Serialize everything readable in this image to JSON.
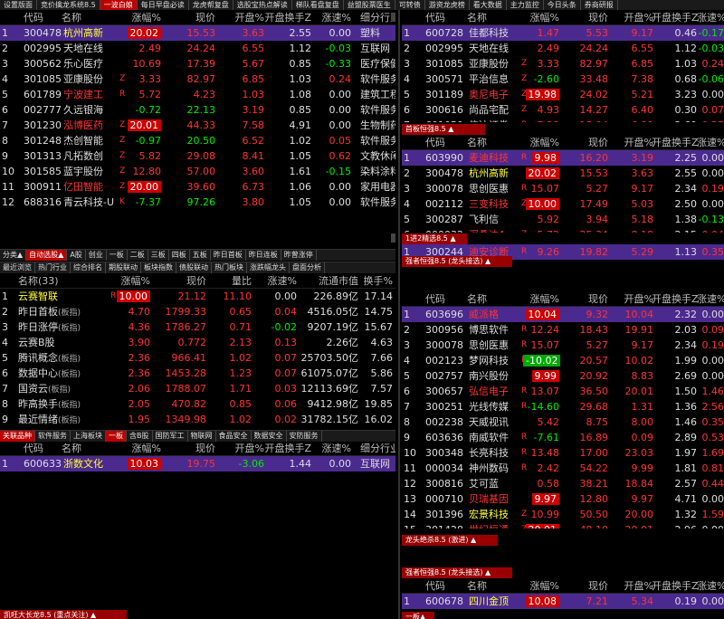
{
  "top_tabs": [
    {
      "label": "设置版面",
      "on": false
    },
    {
      "label": "竞价擒龙系统8.5",
      "on": false
    },
    {
      "label": "一波白娘",
      "on": true
    },
    {
      "label": "每日早盘必读",
      "on": false
    },
    {
      "label": "龙虎帮复盘",
      "on": false
    },
    {
      "label": "选股宝热点解读",
      "on": false
    },
    {
      "label": "梯队看盘复盘",
      "on": false
    },
    {
      "label": "益盟股票医生",
      "on": false
    },
    {
      "label": "可转债",
      "on": false
    },
    {
      "label": "游资龙虎榜",
      "on": false
    },
    {
      "label": "看大数据",
      "on": false
    },
    {
      "label": "主力监控",
      "on": false
    },
    {
      "label": "今日头条",
      "on": false
    },
    {
      "label": "券商研报",
      "on": false
    }
  ],
  "left_table": {
    "headers": {
      "code": "代码",
      "name": "名称",
      "chg": "涨幅%",
      "price": "现价",
      "open": "开盘%",
      "turn": "开盘换手Z",
      "speed": "涨速%",
      "ind": "细分行业"
    },
    "rows": [
      {
        "i": "1",
        "code": "300478",
        "name": "杭州高新",
        "mk": "",
        "chg": "20.02",
        "price": "15.53",
        "open": "3.63",
        "turn": "2.55",
        "speed": "0.00",
        "ind": "塑料",
        "cc": "red",
        "box": "r",
        "hl": true
      },
      {
        "i": "2",
        "code": "002995",
        "name": "天地在线",
        "mk": "",
        "chg": "2.49",
        "price": "24.24",
        "open": "6.55",
        "turn": "1.12",
        "speed": "-0.03",
        "ind": "互联网",
        "cc": "red",
        "box": "",
        "hl": false
      },
      {
        "i": "3",
        "code": "300562",
        "name": "乐心医疗",
        "mk": "",
        "chg": "10.69",
        "price": "17.39",
        "open": "5.67",
        "turn": "0.85",
        "speed": "-0.33",
        "ind": "医疗保健",
        "cc": "red",
        "box": "",
        "hl": false
      },
      {
        "i": "4",
        "code": "301085",
        "name": "亚康股份",
        "mk": "Z",
        "chg": "3.33",
        "price": "82.97",
        "open": "6.85",
        "turn": "1.03",
        "speed": "0.24",
        "ind": "软件服务",
        "cc": "red",
        "box": "",
        "hl": false
      },
      {
        "i": "5",
        "code": "601789",
        "name": "宁波建工",
        "mk": "R",
        "chg": "5.72",
        "price": "4.23",
        "open": "1.03",
        "turn": "1.08",
        "speed": "0.00",
        "ind": "建筑工程",
        "cc": "red",
        "box": "",
        "hl": false
      },
      {
        "i": "6",
        "code": "002777",
        "name": "久远银海",
        "mk": "",
        "chg": "-0.72",
        "price": "22.13",
        "open": "3.19",
        "turn": "0.85",
        "speed": "0.00",
        "ind": "软件服务",
        "cc": "grn",
        "box": "",
        "hl": false
      },
      {
        "i": "7",
        "code": "301230",
        "name": "泓博医药",
        "mk": "Z",
        "chg": "20.01",
        "price": "44.33",
        "open": "7.58",
        "turn": "4.91",
        "speed": "0.00",
        "ind": "生物制药",
        "cc": "red",
        "box": "r",
        "hl": false
      },
      {
        "i": "8",
        "code": "301248",
        "name": "杰创智能",
        "mk": "Z",
        "chg": "-0.97",
        "price": "20.50",
        "open": "6.52",
        "turn": "1.02",
        "speed": "0.05",
        "ind": "软件服务",
        "cc": "grn",
        "box": "",
        "hl": false
      },
      {
        "i": "9",
        "code": "301313",
        "name": "凡拓数创",
        "mk": "Z",
        "chg": "5.82",
        "price": "29.08",
        "open": "8.41",
        "turn": "1.05",
        "speed": "0.62",
        "ind": "文教休闲",
        "cc": "red",
        "box": "",
        "hl": false
      },
      {
        "i": "10",
        "code": "301585",
        "name": "蓝宇股份",
        "mk": "Z",
        "chg": "12.80",
        "price": "57.00",
        "open": "3.60",
        "turn": "1.61",
        "speed": "-0.15",
        "ind": "染料涂料",
        "cc": "red",
        "box": "",
        "hl": false
      },
      {
        "i": "11",
        "code": "300911",
        "name": "亿田智能",
        "mk": "Z",
        "chg": "20.00",
        "price": "39.60",
        "open": "6.73",
        "turn": "1.06",
        "speed": "0.00",
        "ind": "家用电器",
        "cc": "red",
        "box": "r",
        "hl": false
      },
      {
        "i": "12",
        "code": "688316",
        "name": "青云科技-U",
        "mk": "K",
        "chg": "-7.37",
        "price": "97.26",
        "open": "3.80",
        "turn": "1.05",
        "speed": "0.00",
        "ind": "软件服务",
        "cc": "grn",
        "box": "",
        "hl": false
      }
    ]
  },
  "mid_bar1": [
    {
      "label": "分类▲",
      "on": false
    },
    {
      "label": "自动选股▲",
      "on": true
    },
    {
      "label": "A股",
      "on": false
    },
    {
      "label": "创业",
      "on": false
    },
    {
      "label": "一板",
      "on": false
    },
    {
      "label": "二板",
      "on": false
    },
    {
      "label": "三板",
      "on": false
    },
    {
      "label": "四板",
      "on": false
    },
    {
      "label": "五板",
      "on": false
    },
    {
      "label": "昨日首板",
      "on": false
    },
    {
      "label": "昨日连板",
      "on": false
    },
    {
      "label": "昨曾涨停",
      "on": false
    }
  ],
  "mid_bar2": [
    {
      "label": "最近浏览",
      "on": false
    },
    {
      "label": "热门行业",
      "on": false
    },
    {
      "label": "综合排名",
      "on": false
    },
    {
      "label": "期股联动",
      "on": false
    },
    {
      "label": "板块指数",
      "on": false
    },
    {
      "label": "债股联动",
      "on": false
    },
    {
      "label": "热门板块",
      "on": false
    },
    {
      "label": "涨跌幅龙头",
      "on": false
    },
    {
      "label": "盘面分析",
      "on": false
    }
  ],
  "board_table": {
    "headers": {
      "name": "名称(33)",
      "chg": "涨幅%",
      "price": "现价",
      "ratio": "量比",
      "speed": "涨速%",
      "cap": "流通市值",
      "turn": "换手%"
    },
    "rows": [
      {
        "i": "1",
        "name": "云赛智联",
        "sub": "",
        "chg": "10.00",
        "price": "21.12",
        "ratio": "11.10",
        "speed": "0.00",
        "cap": "226.89亿",
        "turn": "17.14",
        "cc": "red",
        "box": "r",
        "nc": "ylw"
      },
      {
        "i": "2",
        "name": "昨日首板",
        "sub": "(板指)",
        "chg": "4.70",
        "price": "1799.33",
        "ratio": "0.65",
        "speed": "0.04",
        "cap": "4516.05亿",
        "turn": "14.75",
        "cc": "red",
        "box": "",
        "nc": "wht"
      },
      {
        "i": "3",
        "name": "昨日涨停",
        "sub": "(板指)",
        "chg": "4.36",
        "price": "1786.27",
        "ratio": "0.71",
        "speed": "-0.02",
        "cap": "9207.19亿",
        "turn": "15.67",
        "cc": "red",
        "box": "",
        "nc": "wht"
      },
      {
        "i": "4",
        "name": "云赛B股",
        "sub": "",
        "chg": "3.90",
        "price": "0.772",
        "ratio": "2.13",
        "speed": "0.13",
        "cap": "2.26亿",
        "turn": "4.63",
        "cc": "red",
        "box": "",
        "nc": "wht"
      },
      {
        "i": "5",
        "name": "腾讯概念",
        "sub": "(板指)",
        "chg": "2.36",
        "price": "966.41",
        "ratio": "1.02",
        "speed": "0.07",
        "cap": "25703.50亿",
        "turn": "7.66",
        "cc": "red",
        "box": "",
        "nc": "wht"
      },
      {
        "i": "6",
        "name": "数据中心",
        "sub": "(板指)",
        "chg": "2.36",
        "price": "1453.28",
        "ratio": "1.23",
        "speed": "0.07",
        "cap": "61075.07亿",
        "turn": "5.86",
        "cc": "red",
        "box": "",
        "nc": "wht"
      },
      {
        "i": "7",
        "name": "国资云",
        "sub": "(板指)",
        "chg": "2.06",
        "price": "1788.07",
        "ratio": "1.71",
        "speed": "0.03",
        "cap": "12113.69亿",
        "turn": "7.57",
        "cc": "red",
        "box": "",
        "nc": "wht"
      },
      {
        "i": "8",
        "name": "昨高换手",
        "sub": "(板指)",
        "chg": "2.05",
        "price": "470.82",
        "ratio": "0.85",
        "speed": "0.06",
        "cap": "9412.98亿",
        "turn": "19.85",
        "cc": "red",
        "box": "",
        "nc": "wht"
      },
      {
        "i": "9",
        "name": "最近情绪",
        "sub": "(板指)",
        "chg": "1.95",
        "price": "1349.98",
        "ratio": "1.02",
        "speed": "0.02",
        "cap": "31782.15亿",
        "turn": "16.02",
        "cc": "red",
        "box": "",
        "nc": "wht"
      },
      {
        "i": "10",
        "name": "东数西算",
        "sub": "(板指)",
        "chg": "1.64",
        "price": "1497.85",
        "ratio": "1.16",
        "speed": "0.04",
        "cap": "39765.02亿",
        "turn": "8.35",
        "cc": "red",
        "box": "",
        "nc": "wht"
      }
    ]
  },
  "mid_bar3": [
    {
      "label": "关联品种",
      "on": true
    },
    {
      "label": "软件服务",
      "on": false
    },
    {
      "label": "上海板块",
      "on": false
    },
    {
      "label": "一板",
      "on": true
    },
    {
      "label": "含B股",
      "on": false
    },
    {
      "label": "国防军工",
      "on": false
    },
    {
      "label": "物联网",
      "on": false
    },
    {
      "label": "食品安全",
      "on": false
    },
    {
      "label": "数据安全",
      "on": false
    },
    {
      "label": "安防服务",
      "on": false
    }
  ],
  "assoc_table": {
    "headers": {
      "code": "代码",
      "name": "名称",
      "chg": "涨幅%",
      "price": "现价",
      "open": "开盘%",
      "turn": "开盘换手Z",
      "speed": "涨速%",
      "ind": "细分行业"
    },
    "rows": [
      {
        "i": "1",
        "code": "600633",
        "name": "浙数文化",
        "mk": "",
        "chg": "10.03",
        "price": "19.75",
        "open": "-3.06",
        "turn": "1.44",
        "speed": "0.00",
        "ind": "互联网",
        "cc": "red",
        "box": "r",
        "hl": true
      }
    ]
  },
  "bottom_left_label": "凯旺大长龙8.5 (重点关注) ▲",
  "right_headers": {
    "code": "代码",
    "name": "名称",
    "chg": "涨幅%",
    "price": "现价",
    "open": "开盘%",
    "turn": "开盘换手Z",
    "speed": "涨速%"
  },
  "right_s1": {
    "rows": [
      {
        "i": "1",
        "code": "600728",
        "name": "佳都科技",
        "mk": "",
        "chg": "1.47",
        "price": "5.53",
        "open": "9.17",
        "turn": "0.46",
        "speed": "-0.17",
        "cc": "red",
        "box": "",
        "hl": true
      },
      {
        "i": "2",
        "code": "002995",
        "name": "天地在线",
        "mk": "",
        "chg": "2.49",
        "price": "24.24",
        "open": "6.55",
        "turn": "1.12",
        "speed": "-0.03",
        "cc": "red",
        "box": "",
        "hl": false
      },
      {
        "i": "3",
        "code": "301085",
        "name": "亚康股份",
        "mk": "Z",
        "chg": "3.33",
        "price": "82.97",
        "open": "6.85",
        "turn": "1.03",
        "speed": "0.24",
        "cc": "red",
        "box": "",
        "hl": false
      },
      {
        "i": "4",
        "code": "300571",
        "name": "平治信息",
        "mk": "Z",
        "chg": "-2.60",
        "price": "33.48",
        "open": "7.38",
        "turn": "0.68",
        "speed": "-0.06",
        "cc": "grn",
        "box": "",
        "hl": false
      },
      {
        "i": "5",
        "code": "301189",
        "name": "奥尼电子",
        "mk": "Z",
        "chg": "19.98",
        "price": "24.02",
        "open": "5.21",
        "turn": "3.23",
        "speed": "0.00",
        "cc": "red",
        "box": "r",
        "hl": false
      },
      {
        "i": "6",
        "code": "300616",
        "name": "尚品宅配",
        "mk": "Z",
        "chg": "4.93",
        "price": "14.27",
        "open": "6.40",
        "turn": "0.30",
        "speed": "0.07",
        "cc": "red",
        "box": "",
        "hl": false
      },
      {
        "i": "7",
        "code": "601059",
        "name": "信达证券",
        "mk": "R",
        "chg": "7.28",
        "price": "15.04",
        "open": "6.99",
        "turn": "2.60",
        "speed": "0.27",
        "cc": "red",
        "box": "",
        "hl": false
      }
    ]
  },
  "right_s2_label": "首板恒强8.5 ▲",
  "right_s2": {
    "rows": [
      {
        "i": "1",
        "code": "603990",
        "name": "麦迪科技",
        "mk": "R",
        "chg": "9.98",
        "price": "16.20",
        "open": "3.19",
        "turn": "2.25",
        "speed": "0.00",
        "cc": "red",
        "box": "r",
        "hl": true
      },
      {
        "i": "2",
        "code": "300478",
        "name": "杭州高新",
        "mk": "",
        "chg": "20.02",
        "price": "15.53",
        "open": "3.63",
        "turn": "2.55",
        "speed": "0.00",
        "cc": "red",
        "box": "r",
        "hl": false
      },
      {
        "i": "3",
        "code": "300078",
        "name": "思创医惠",
        "mk": "R",
        "chg": "15.07",
        "price": "5.27",
        "open": "9.17",
        "turn": "2.34",
        "speed": "0.19",
        "cc": "red",
        "box": "",
        "hl": false
      },
      {
        "i": "4",
        "code": "002112",
        "name": "三变科技",
        "mk": "Z",
        "chg": "10.00",
        "price": "17.49",
        "open": "5.03",
        "turn": "2.50",
        "speed": "0.00",
        "cc": "red",
        "box": "r",
        "hl": false
      },
      {
        "i": "5",
        "code": "300287",
        "name": "飞利信",
        "mk": "",
        "chg": "5.92",
        "price": "3.94",
        "open": "5.18",
        "turn": "1.38",
        "speed": "-0.13",
        "cc": "red",
        "box": "",
        "hl": false
      },
      {
        "i": "6",
        "code": "000032",
        "name": "深桑达A",
        "mk": "Z",
        "chg": "5.72",
        "price": "25.34",
        "open": "8.18",
        "turn": "2.15",
        "speed": "0.04",
        "cc": "red",
        "box": "",
        "hl": false
      }
    ]
  },
  "right_s3_label": "1进2精选8.5 ▲",
  "right_s3": {
    "rows": [
      {
        "i": "1",
        "code": "300244",
        "name": "迪安诊断",
        "mk": "R",
        "chg": "9.26",
        "price": "19.82",
        "open": "5.29",
        "turn": "1.13",
        "speed": "0.35",
        "cc": "red",
        "box": "",
        "hl": true
      }
    ]
  },
  "right_s4_label": "强者恒强8.5 (龙头接选) ▲",
  "right_s4": {
    "rows": [
      {
        "i": "1",
        "code": "603696",
        "name": "威派格",
        "mk": "",
        "chg": "10.04",
        "price": "9.32",
        "open": "10.04",
        "turn": "2.32",
        "speed": "0.00",
        "cc": "red",
        "box": "r",
        "hl": true
      },
      {
        "i": "2",
        "code": "300956",
        "name": "博思软件",
        "mk": "R",
        "chg": "12.24",
        "price": "18.43",
        "open": "19.91",
        "turn": "2.03",
        "speed": "0.09",
        "cc": "red",
        "box": "",
        "hl": false
      },
      {
        "i": "3",
        "code": "300078",
        "name": "思创医惠",
        "mk": "R",
        "chg": "15.07",
        "price": "5.27",
        "open": "9.17",
        "turn": "2.34",
        "speed": "0.19",
        "cc": "red",
        "box": "",
        "hl": false
      },
      {
        "i": "4",
        "code": "002123",
        "name": "梦网科技",
        "mk": "R",
        "chg": "-10.02",
        "price": "20.57",
        "open": "10.02",
        "turn": "1.99",
        "speed": "0.00",
        "cc": "grn",
        "box": "g",
        "hl": false
      },
      {
        "i": "5",
        "code": "002757",
        "name": "南兴股份",
        "mk": "",
        "chg": "9.99",
        "price": "20.92",
        "open": "8.83",
        "turn": "2.69",
        "speed": "0.00",
        "cc": "red",
        "box": "r",
        "hl": false
      },
      {
        "i": "6",
        "code": "300657",
        "name": "弘信电子",
        "mk": "R",
        "chg": "13.07",
        "price": "36.50",
        "open": "20.01",
        "turn": "1.50",
        "speed": "1.46",
        "cc": "red",
        "box": "",
        "hl": false
      },
      {
        "i": "7",
        "code": "300251",
        "name": "光线传媒",
        "mk": "R",
        "chg": "-14.60",
        "price": "29.68",
        "open": "1.31",
        "turn": "1.36",
        "speed": "2.56",
        "cc": "grn",
        "box": "",
        "hl": false
      },
      {
        "i": "8",
        "code": "002238",
        "name": "天威视讯",
        "mk": "",
        "chg": "5.42",
        "price": "8.75",
        "open": "8.00",
        "turn": "1.46",
        "speed": "0.35",
        "cc": "red",
        "box": "",
        "hl": false
      },
      {
        "i": "9",
        "code": "603636",
        "name": "南威软件",
        "mk": "R",
        "chg": "-7.61",
        "price": "16.89",
        "open": "0.09",
        "turn": "2.89",
        "speed": "0.53",
        "cc": "grn",
        "box": "",
        "hl": false
      },
      {
        "i": "10",
        "code": "300348",
        "name": "长亮科技",
        "mk": "R",
        "chg": "13.48",
        "price": "17.00",
        "open": "23.03",
        "turn": "1.97",
        "speed": "1.69",
        "cc": "red",
        "box": "",
        "hl": false
      },
      {
        "i": "11",
        "code": "000034",
        "name": "神州数码",
        "mk": "R",
        "chg": "2.42",
        "price": "54.22",
        "open": "9.99",
        "turn": "1.81",
        "speed": "0.81",
        "cc": "red",
        "box": "",
        "hl": false
      },
      {
        "i": "12",
        "code": "300816",
        "name": "艾可蓝",
        "mk": "",
        "chg": "0.58",
        "price": "38.21",
        "open": "18.84",
        "turn": "2.57",
        "speed": "0.44",
        "cc": "red",
        "box": "",
        "hl": false
      },
      {
        "i": "13",
        "code": "000710",
        "name": "贝瑞基因",
        "mk": "",
        "chg": "9.97",
        "price": "12.80",
        "open": "9.97",
        "turn": "4.71",
        "speed": "0.00",
        "cc": "red",
        "box": "r",
        "hl": false
      },
      {
        "i": "14",
        "code": "301396",
        "name": "宏景科技",
        "mk": "Z",
        "chg": "10.99",
        "price": "50.50",
        "open": "20.00",
        "turn": "1.32",
        "speed": "1.59",
        "cc": "red",
        "box": "",
        "hl": false
      },
      {
        "i": "15",
        "code": "301428",
        "name": "世纪恒通",
        "mk": "Z",
        "chg": "20.01",
        "price": "48.10",
        "open": "20.01",
        "turn": "2.96",
        "speed": "0.00",
        "cc": "red",
        "box": "r",
        "hl": false
      },
      {
        "i": "16",
        "code": "301602",
        "name": "超研股份",
        "mk": "Z",
        "chg": "14.82",
        "price": "31.14",
        "open": "15.93",
        "turn": "3.80",
        "speed": "-1.24",
        "cc": "red",
        "box": "",
        "hl": false
      }
    ]
  },
  "right_s5_label": "龙头绝杀8.5 (激进) ▲",
  "right_s6_label": "强者恒强8.5 (龙头接选) ▲",
  "right_s6": {
    "rows": [
      {
        "i": "1",
        "code": "600678",
        "name": "四川金顶",
        "mk": "",
        "chg": "10.08",
        "price": "7.21",
        "open": "5.34",
        "turn": "0.19",
        "speed": "0.00",
        "cc": "red",
        "box": "r",
        "hl": true
      }
    ]
  },
  "bottom_right_label": "一板▲"
}
